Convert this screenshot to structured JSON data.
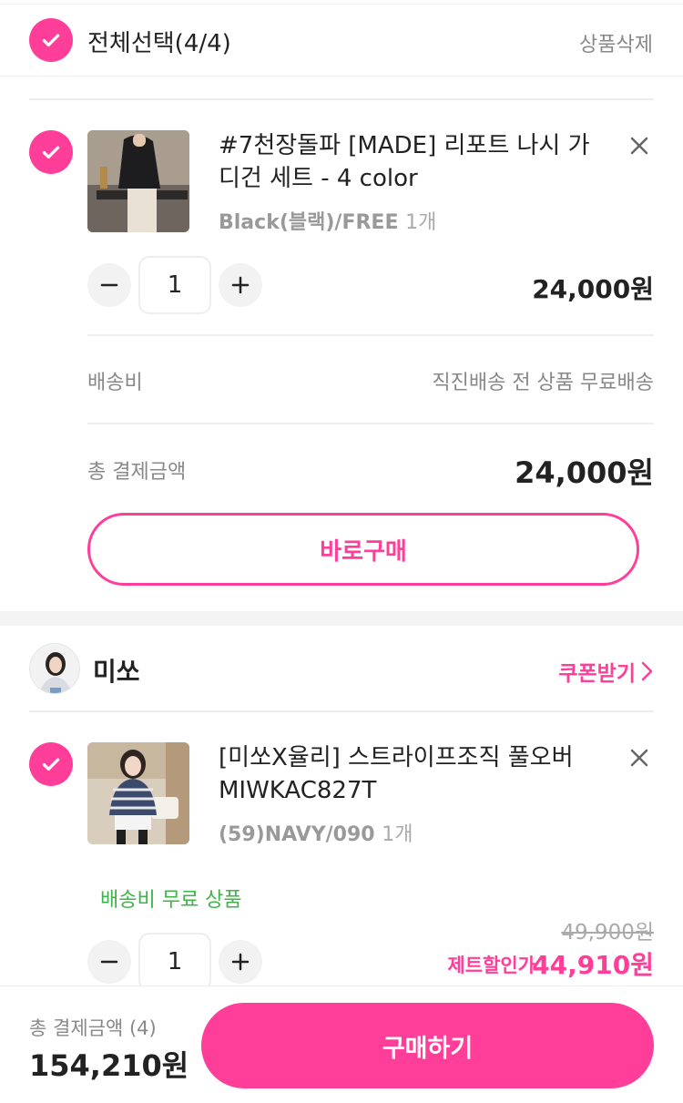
{
  "header": {
    "select_all_label": "전체선택(4/4)",
    "delete_label": "상품삭제"
  },
  "item1": {
    "title": "#7천장돌파 [MADE] 리포트 나시 가디건 세트 - 4 color",
    "option": "Black(블랙)/FREE",
    "count": "1개",
    "quantity": "1",
    "price": "24,000원"
  },
  "summary1": {
    "shipping_label": "배송비",
    "shipping_value": "직진배송 전 상품 무료배송",
    "total_label": "총 결제금액",
    "total_value": "24,000원",
    "buy_now_label": "바로구매"
  },
  "seller": {
    "name": "미쏘",
    "coupon_label": "쿠폰받기"
  },
  "item2": {
    "title": "[미쏘X율리] 스트라이프조직 풀오버 MIWKAC827T",
    "option": "(59)NAVY/090",
    "count": "1개",
    "free_shipping": "배송비 무료 상품",
    "quantity": "1",
    "original_price": "49,900원",
    "discount_label": "제트할인가",
    "discount_price": "44,910원"
  },
  "footer": {
    "total_label": "총 결제금액 (4)",
    "total_value": "154,210원",
    "order_label": "구매하기"
  },
  "colors": {
    "accent": "#ff3e99",
    "free_shipping": "#3db44a"
  }
}
